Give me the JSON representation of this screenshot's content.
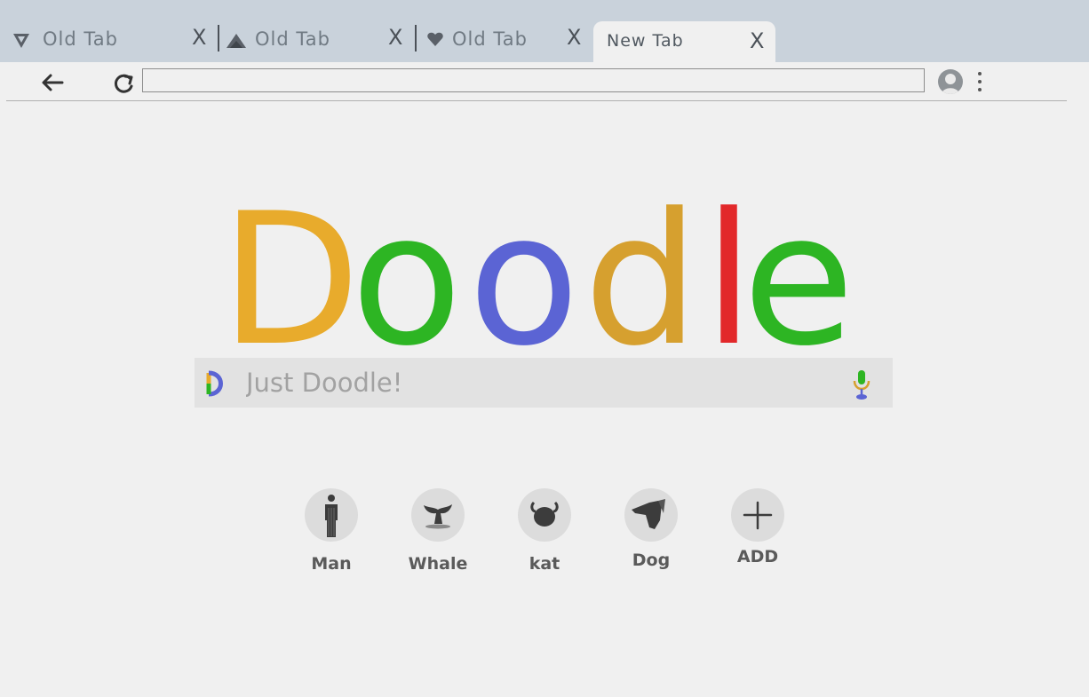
{
  "tabs": [
    {
      "label": "Old  Tab",
      "icon": "shield-icon",
      "close": "X"
    },
    {
      "label": "Old  Tab",
      "icon": "mountain-icon",
      "close": "X"
    },
    {
      "label": "Old  Tab",
      "icon": "heart-icon",
      "close": "X"
    },
    {
      "label": "New  Tab",
      "icon": null,
      "close": "X",
      "active": true
    }
  ],
  "toolbar": {
    "back_icon": "back-arrow-icon",
    "reload_icon": "reload-icon",
    "address": "",
    "profile_icon": "avatar-icon",
    "menu_icon": "vertical-dots-icon"
  },
  "logo": {
    "letters": [
      {
        "char": "D",
        "color": "#e8ab2c"
      },
      {
        "char": "o",
        "color": "#2db523"
      },
      {
        "char": "o",
        "color": "#5b64d4"
      },
      {
        "char": "d",
        "color": "#d6a02f"
      },
      {
        "char": "l",
        "color": "#e2282a"
      },
      {
        "char": "e",
        "color": "#2db523"
      }
    ]
  },
  "search": {
    "placeholder": "Just Doodle!",
    "value": "",
    "logo_icon": "doodle-d-icon",
    "mic_icon": "microphone-icon"
  },
  "shortcuts": [
    {
      "label": "Man",
      "icon": "man-icon"
    },
    {
      "label": "Whale",
      "icon": "whale-tail-icon"
    },
    {
      "label": "kat",
      "icon": "cat-icon"
    },
    {
      "label": "Dog",
      "icon": "dog-icon"
    },
    {
      "label": "ADD",
      "icon": "plus-icon"
    }
  ],
  "colors": {
    "tabstrip": "#c9d2db",
    "page_bg": "#f0f0f0",
    "search_bg": "#e2e2e2",
    "shortcut_bg": "#dcdcdc"
  }
}
